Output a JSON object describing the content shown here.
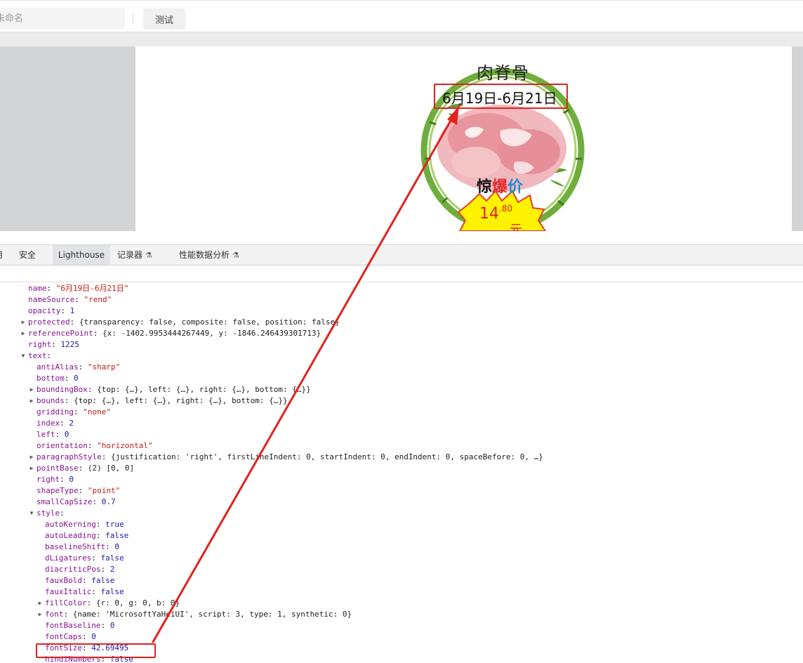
{
  "toolbar": {
    "name_placeholder": "未命名",
    "test_button": "测试"
  },
  "poster": {
    "title": "肉脊骨",
    "date": "6月19日-6月21日",
    "label_chars": [
      "惊",
      "爆",
      "价"
    ],
    "price_main": "14",
    "price_decimal": ".80",
    "price_unit": "元"
  },
  "devtools_tabs": [
    {
      "label": "用",
      "active": false
    },
    {
      "label": "安全",
      "active": false
    },
    {
      "label": "Lighthouse",
      "active": true
    },
    {
      "label": "记录器",
      "active": false,
      "experimental": true
    },
    {
      "label": "性能数据分析",
      "active": false,
      "experimental": true
    }
  ],
  "properties": [
    {
      "key": "name",
      "value": "\"6月19日-6月21日\"",
      "type": "string"
    },
    {
      "key": "nameSource",
      "value": "\"rend\"",
      "type": "string"
    },
    {
      "key": "opacity",
      "value": "1",
      "type": "number"
    },
    {
      "key": "protected",
      "value": "{transparency: false, composite: false, position: false}",
      "type": "object",
      "expandable": true
    },
    {
      "key": "referencePoint",
      "value": "{x: -1402.9953444267449, y: -1846.246439301713}",
      "type": "object",
      "expandable": true
    },
    {
      "key": "right",
      "value": "1225",
      "type": "number"
    },
    {
      "key": "text",
      "value": "",
      "type": "object",
      "expanded": true
    },
    {
      "key": "antiAlias",
      "value": "\"sharp\"",
      "type": "string"
    },
    {
      "key": "bottom",
      "value": "0",
      "type": "number"
    },
    {
      "key": "boundingBox",
      "value": "{top: {…}, left: {…}, right: {…}, bottom: {…}}",
      "type": "object",
      "expandable": true
    },
    {
      "key": "bounds",
      "value": "{top: {…}, left: {…}, right: {…}, bottom: {…}}",
      "type": "object",
      "expandable": true
    },
    {
      "key": "gridding",
      "value": "\"none\"",
      "type": "string"
    },
    {
      "key": "index",
      "value": "2",
      "type": "number"
    },
    {
      "key": "left",
      "value": "0",
      "type": "number"
    },
    {
      "key": "orientation",
      "value": "\"horizontal\"",
      "type": "string"
    },
    {
      "key": "paragraphStyle",
      "value": "{justification: 'right', firstLineIndent: 0, startIndent: 0, endIndent: 0, spaceBefore: 0, …}",
      "type": "object",
      "expandable": true
    },
    {
      "key": "pointBase",
      "value": "(2) [0, 0]",
      "type": "object",
      "expandable": true
    },
    {
      "key": "right",
      "value": "0",
      "type": "number"
    },
    {
      "key": "shapeType",
      "value": "\"point\"",
      "type": "string"
    },
    {
      "key": "smallCapSize",
      "value": "0.7",
      "type": "number"
    },
    {
      "key": "style",
      "value": "",
      "type": "object",
      "expanded": true
    },
    {
      "key": "autoKerning",
      "value": "true",
      "type": "number"
    },
    {
      "key": "autoLeading",
      "value": "false",
      "type": "number"
    },
    {
      "key": "baselineShift",
      "value": "0",
      "type": "number"
    },
    {
      "key": "dLigatures",
      "value": "false",
      "type": "number"
    },
    {
      "key": "diacriticPos",
      "value": "2",
      "type": "number"
    },
    {
      "key": "fauxBold",
      "value": "false",
      "type": "number"
    },
    {
      "key": "fauxItalic",
      "value": "false",
      "type": "number"
    },
    {
      "key": "fillColor",
      "value": "{r: 0, g: 0, b: 0}",
      "type": "object",
      "expandable": true
    },
    {
      "key": "font",
      "value": "{name: 'MicrosoftYaHeiUI', script: 3, type: 1, synthetic: 0}",
      "type": "object",
      "expandable": true
    },
    {
      "key": "fontBaseline",
      "value": "0",
      "type": "number"
    },
    {
      "key": "fontCaps",
      "value": "0",
      "type": "number"
    },
    {
      "key": "fontSize",
      "value": "42.69495",
      "type": "number",
      "highlighted": true
    },
    {
      "key": "hindiNumbers",
      "value": "false",
      "type": "number"
    }
  ],
  "colors": {
    "highlight": "#e3221e",
    "key": "#881391",
    "string": "#c41a16",
    "number": "#1a1aa6"
  }
}
